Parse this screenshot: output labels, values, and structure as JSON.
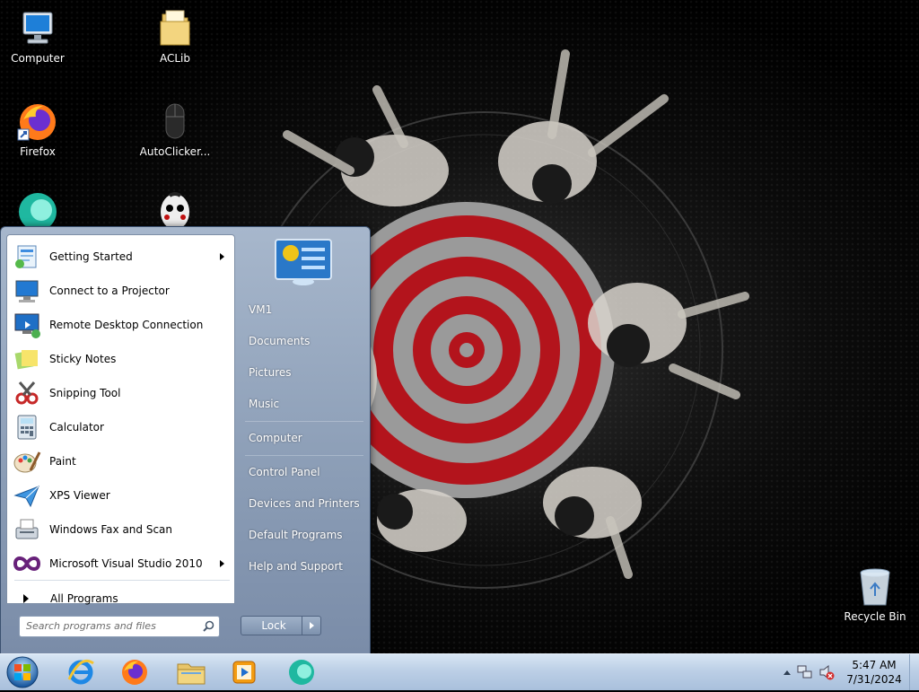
{
  "desktop": {
    "icons": [
      {
        "label": "Computer",
        "icon": "computer-icon"
      },
      {
        "label": "ACLib",
        "icon": "folder-icon"
      },
      {
        "label": "Firefox",
        "icon": "firefox-icon"
      },
      {
        "label": "AutoClicker...",
        "icon": "mouse-icon"
      },
      {
        "label": "",
        "icon": "teal-app-icon"
      },
      {
        "label": "",
        "icon": "jigsaw-puppet-icon"
      },
      {
        "label": "Recycle Bin",
        "icon": "recycle-bin-icon"
      }
    ]
  },
  "start_menu": {
    "programs": [
      {
        "label": "Getting Started",
        "icon": "getting-started-icon",
        "submenu": true
      },
      {
        "label": "Connect to a Projector",
        "icon": "projector-icon",
        "submenu": false
      },
      {
        "label": "Remote Desktop Connection",
        "icon": "remote-desktop-icon",
        "submenu": false
      },
      {
        "label": "Sticky Notes",
        "icon": "sticky-notes-icon",
        "submenu": false
      },
      {
        "label": "Snipping Tool",
        "icon": "snipping-tool-icon",
        "submenu": false
      },
      {
        "label": "Calculator",
        "icon": "calculator-icon",
        "submenu": false
      },
      {
        "label": "Paint",
        "icon": "paint-icon",
        "submenu": false
      },
      {
        "label": "XPS Viewer",
        "icon": "xps-viewer-icon",
        "submenu": false
      },
      {
        "label": "Windows Fax and Scan",
        "icon": "fax-scan-icon",
        "submenu": false
      },
      {
        "label": "Microsoft Visual Studio 2010",
        "icon": "visual-studio-icon",
        "submenu": true
      }
    ],
    "all_programs": "All Programs",
    "search_placeholder": "Search programs and files",
    "right_links": [
      "VM1",
      "Documents",
      "Pictures",
      "Music",
      "Computer",
      "Control Panel",
      "Devices and Printers",
      "Default Programs",
      "Help and Support"
    ],
    "lock_label": "Lock"
  },
  "taskbar": {
    "pinned": [
      {
        "name": "internet-explorer-icon"
      },
      {
        "name": "firefox-icon"
      },
      {
        "name": "windows-explorer-icon"
      },
      {
        "name": "media-player-icon"
      },
      {
        "name": "teal-app-icon"
      }
    ],
    "clock_time": "5:47 AM",
    "clock_date": "7/31/2024"
  },
  "colors": {
    "taskbar": "#bccfe6",
    "start_menu_right": "#8a9cb5",
    "wallpaper_red": "#b3141c"
  }
}
